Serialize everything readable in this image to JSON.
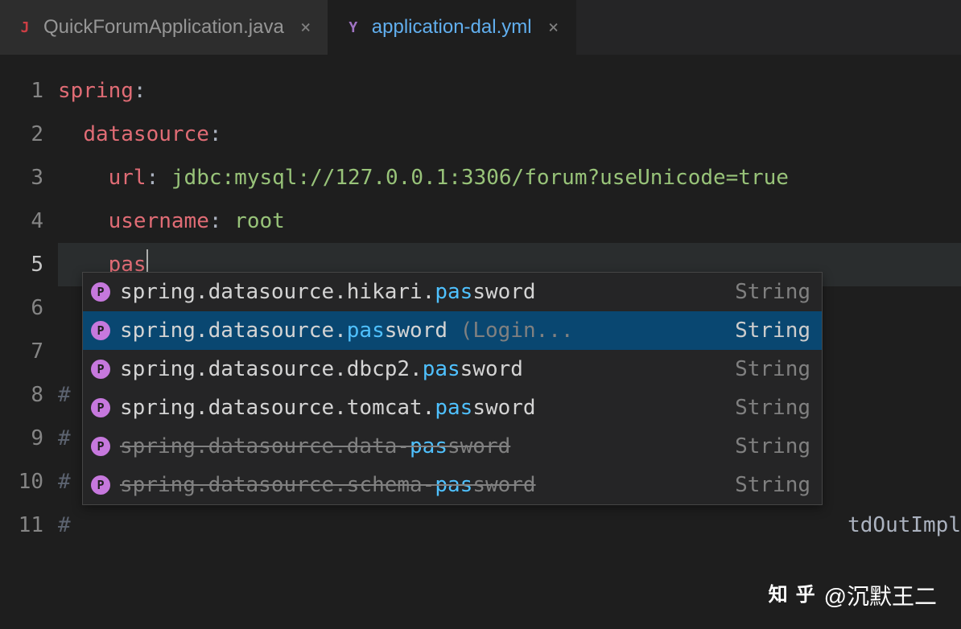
{
  "tabs": [
    {
      "label": "QuickForumApplication.java",
      "icon": "J",
      "active": false
    },
    {
      "label": "application-dal.yml",
      "icon": "Y",
      "active": true
    }
  ],
  "lines": {
    "numbers": [
      "1",
      "2",
      "3",
      "4",
      "5",
      "6",
      "7",
      "8",
      "9",
      "10",
      "11"
    ],
    "l1_key": "spring",
    "l2_key": "datasource",
    "l3_key": "url",
    "l3_val": "jdbc:mysql://127.0.0.1:3306/forum?useUnicode=true",
    "l4_key": "username",
    "l4_val": "root",
    "l5_typed": "pas",
    "l8_prefix": "#",
    "l9_prefix": "#",
    "l10_prefix": "#",
    "l11_prefix": "#",
    "l11_suffix": "tdOutImpl"
  },
  "autocomplete": {
    "items": [
      {
        "pre": "spring.datasource.hikari.",
        "match": "pas",
        "post": "sword",
        "type": "String",
        "deprecated": false
      },
      {
        "pre": "spring.datasource.",
        "match": "pas",
        "post": "sword",
        "hint": "(Login...",
        "type": "String",
        "deprecated": false,
        "selected": true
      },
      {
        "pre": "spring.datasource.dbcp2.",
        "match": "pas",
        "post": "sword",
        "type": "String",
        "deprecated": false
      },
      {
        "pre": "spring.datasource.tomcat.",
        "match": "pas",
        "post": "sword",
        "type": "String",
        "deprecated": false
      },
      {
        "pre": "spring.datasource.data-",
        "match": "pas",
        "post": "sword",
        "type": "String",
        "deprecated": true
      },
      {
        "pre": "spring.datasource.schema-",
        "match": "pas",
        "post": "sword",
        "type": "String",
        "deprecated": true
      }
    ]
  },
  "watermark": {
    "logo1": "知",
    "logo2": "乎",
    "text": "@沉默王二"
  }
}
